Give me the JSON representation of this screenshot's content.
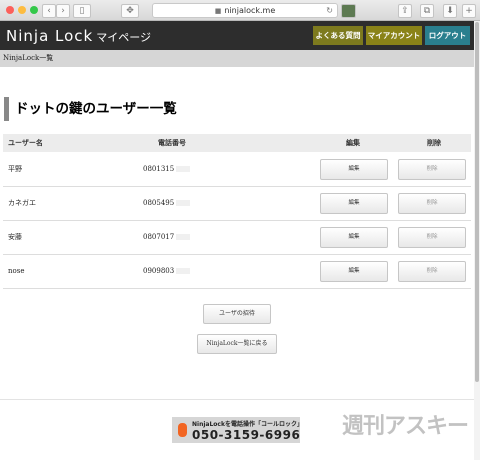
{
  "browser": {
    "url": "ninjalock.me"
  },
  "header": {
    "logo_main": "Ninja Lock",
    "logo_sub": "マイページ",
    "faq": "よくある質問",
    "account": "マイアカウント",
    "logout": "ログアウト",
    "colors": {
      "faq": "#7d7a1e",
      "account": "#8a8318",
      "logout": "#2a7f8e"
    }
  },
  "breadcrumb": "NinjaLock一覧",
  "title": "ドットの鍵のユーザー一覧",
  "table": {
    "headers": {
      "name": "ユーザー名",
      "phone": "電話番号",
      "edit": "編集",
      "delete": "削除"
    },
    "rows": [
      {
        "name": "平野",
        "phone": "0801315"
      },
      {
        "name": "カネガエ",
        "phone": "0805495"
      },
      {
        "name": "安藤",
        "phone": "0807017"
      },
      {
        "name": "nose",
        "phone": "0909803"
      }
    ],
    "edit_label": "編集",
    "delete_label": "削除"
  },
  "actions": {
    "invite": "ユーザの招待",
    "back": "NinjaLock一覧に戻る"
  },
  "banner": {
    "line1": "NinjaLockを電話操作「コールロック」",
    "line2": "050-3159-6996"
  },
  "watermark": "週刊アスキー"
}
